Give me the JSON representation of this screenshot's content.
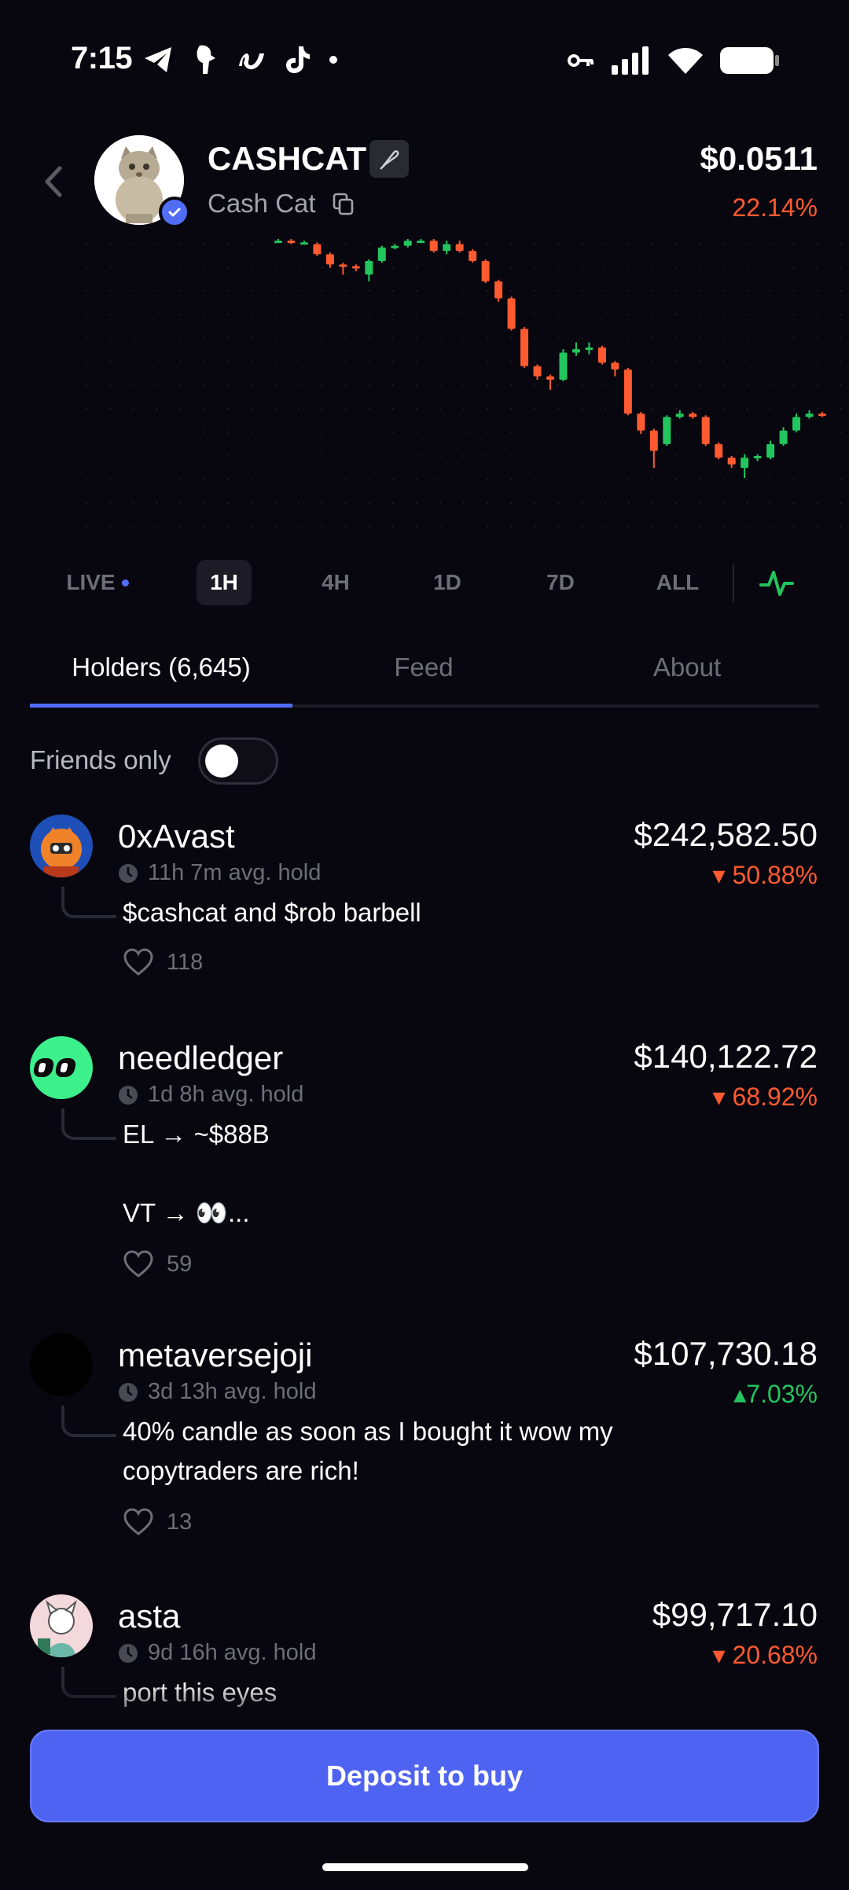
{
  "status_bar": {
    "time": "7:15"
  },
  "header": {
    "symbol": "CASHCAT",
    "name": "Cash Cat",
    "price": "$0.0511",
    "change": "22.14%"
  },
  "colors": {
    "up": "#22c55e",
    "down": "#ff5a30",
    "accent": "#4f63f2",
    "background": "#08070f"
  },
  "chart_data": {
    "type": "candlestick",
    "candles": [
      {
        "o": 1.0,
        "c": 1.0,
        "h": 1.005,
        "l": 0.995
      },
      {
        "o": 1.0,
        "c": 0.995,
        "h": 1.005,
        "l": 0.99
      },
      {
        "o": 0.995,
        "c": 0.995,
        "h": 1.0,
        "l": 0.99
      },
      {
        "o": 0.99,
        "c": 0.96,
        "h": 0.995,
        "l": 0.955
      },
      {
        "o": 0.96,
        "c": 0.93,
        "h": 0.965,
        "l": 0.92
      },
      {
        "o": 0.93,
        "c": 0.925,
        "h": 0.935,
        "l": 0.9
      },
      {
        "o": 0.925,
        "c": 0.92,
        "h": 0.93,
        "l": 0.91
      },
      {
        "o": 0.9,
        "c": 0.94,
        "h": 0.945,
        "l": 0.88
      },
      {
        "o": 0.94,
        "c": 0.98,
        "h": 0.985,
        "l": 0.935
      },
      {
        "o": 0.98,
        "c": 0.985,
        "h": 0.99,
        "l": 0.975
      },
      {
        "o": 0.985,
        "c": 1.0,
        "h": 1.005,
        "l": 0.98
      },
      {
        "o": 1.0,
        "c": 1.0,
        "h": 1.005,
        "l": 0.995
      },
      {
        "o": 1.0,
        "c": 0.97,
        "h": 1.005,
        "l": 0.965
      },
      {
        "o": 0.97,
        "c": 0.99,
        "h": 1.0,
        "l": 0.96
      },
      {
        "o": 0.99,
        "c": 0.97,
        "h": 1.0,
        "l": 0.965
      },
      {
        "o": 0.97,
        "c": 0.94,
        "h": 0.975,
        "l": 0.935
      },
      {
        "o": 0.94,
        "c": 0.88,
        "h": 0.945,
        "l": 0.875
      },
      {
        "o": 0.88,
        "c": 0.83,
        "h": 0.885,
        "l": 0.82
      },
      {
        "o": 0.83,
        "c": 0.74,
        "h": 0.835,
        "l": 0.735
      },
      {
        "o": 0.74,
        "c": 0.63,
        "h": 0.745,
        "l": 0.625
      },
      {
        "o": 0.63,
        "c": 0.6,
        "h": 0.635,
        "l": 0.59
      },
      {
        "o": 0.6,
        "c": 0.59,
        "h": 0.605,
        "l": 0.56
      },
      {
        "o": 0.59,
        "c": 0.67,
        "h": 0.68,
        "l": 0.585
      },
      {
        "o": 0.67,
        "c": 0.68,
        "h": 0.7,
        "l": 0.66
      },
      {
        "o": 0.68,
        "c": 0.685,
        "h": 0.7,
        "l": 0.665
      },
      {
        "o": 0.685,
        "c": 0.64,
        "h": 0.69,
        "l": 0.635
      },
      {
        "o": 0.64,
        "c": 0.62,
        "h": 0.645,
        "l": 0.6
      },
      {
        "o": 0.62,
        "c": 0.49,
        "h": 0.625,
        "l": 0.485
      },
      {
        "o": 0.49,
        "c": 0.44,
        "h": 0.495,
        "l": 0.43
      },
      {
        "o": 0.44,
        "c": 0.38,
        "h": 0.445,
        "l": 0.33
      },
      {
        "o": 0.4,
        "c": 0.48,
        "h": 0.485,
        "l": 0.395
      },
      {
        "o": 0.48,
        "c": 0.49,
        "h": 0.5,
        "l": 0.475
      },
      {
        "o": 0.49,
        "c": 0.48,
        "h": 0.495,
        "l": 0.475
      },
      {
        "o": 0.48,
        "c": 0.4,
        "h": 0.485,
        "l": 0.395
      },
      {
        "o": 0.4,
        "c": 0.36,
        "h": 0.405,
        "l": 0.355
      },
      {
        "o": 0.36,
        "c": 0.34,
        "h": 0.365,
        "l": 0.33
      },
      {
        "o": 0.33,
        "c": 0.36,
        "h": 0.37,
        "l": 0.3
      },
      {
        "o": 0.36,
        "c": 0.365,
        "h": 0.37,
        "l": 0.35
      },
      {
        "o": 0.36,
        "c": 0.4,
        "h": 0.41,
        "l": 0.355
      },
      {
        "o": 0.4,
        "c": 0.44,
        "h": 0.45,
        "l": 0.395
      },
      {
        "o": 0.44,
        "c": 0.48,
        "h": 0.49,
        "l": 0.435
      },
      {
        "o": 0.48,
        "c": 0.49,
        "h": 0.5,
        "l": 0.475
      },
      {
        "o": 0.49,
        "c": 0.485,
        "h": 0.495,
        "l": 0.48
      }
    ]
  },
  "timeframes": {
    "live": "LIVE",
    "h1": "1H",
    "h4": "4H",
    "d1": "1D",
    "d7": "7D",
    "all": "ALL",
    "selected": "1H"
  },
  "tabs": {
    "holders": "Holders (6,645)",
    "feed": "Feed",
    "about": "About"
  },
  "filter": {
    "friends_only": "Friends only",
    "enabled": false
  },
  "holders": [
    {
      "name": "0xAvast",
      "hold": "11h 7m avg. hold",
      "value": "$242,582.50",
      "change": "50.88%",
      "post": "$cashcat and $rob barbell",
      "likes": "118"
    },
    {
      "name": "needledger",
      "hold": "1d 8h avg. hold",
      "value": "$140,122.72",
      "change": "68.92%",
      "post": "EL → ~$88B\n\nVT → 👀...",
      "likes": "59"
    },
    {
      "name": "metaversejoji",
      "hold": "3d 13h avg. hold",
      "value": "$107,730.18",
      "change": "7.03%",
      "post": "40% candle as soon as I bought it wow my copytraders are rich!",
      "likes": "13"
    },
    {
      "name": "asta",
      "hold": "9d 16h avg. hold",
      "value": "$99,717.10",
      "change": "20.68%",
      "post": "port this eyes"
    }
  ],
  "cta": {
    "deposit": "Deposit to buy"
  }
}
